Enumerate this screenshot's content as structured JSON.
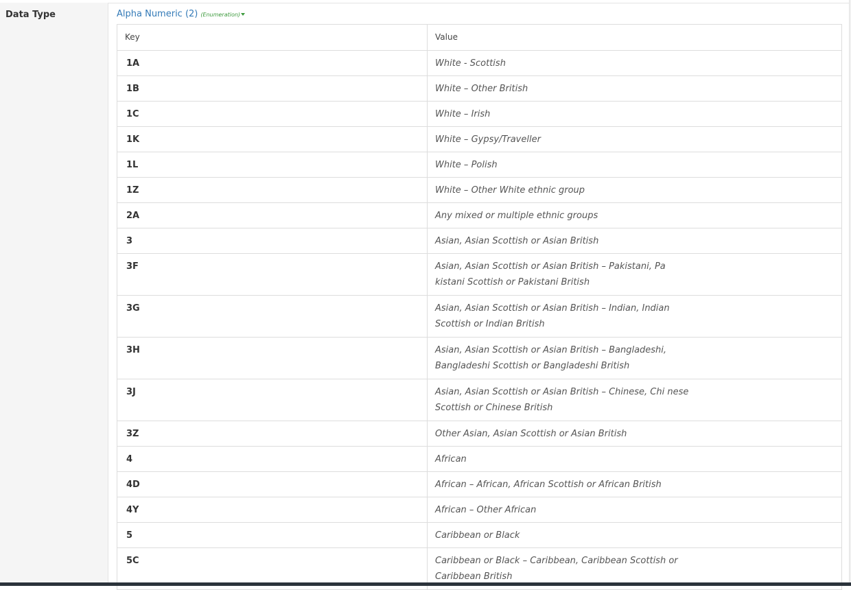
{
  "field_label": "Data Type",
  "data_type": {
    "name": "Alpha Numeric (2)",
    "kind": "(Enumeration)"
  },
  "table": {
    "headers": [
      "Key",
      "Value"
    ],
    "rows": [
      {
        "key": "1A",
        "value": "White - Scottish"
      },
      {
        "key": "1B",
        "value": "White – Other British"
      },
      {
        "key": "1C",
        "value": "White – Irish"
      },
      {
        "key": "1K",
        "value": "White – Gypsy/Traveller"
      },
      {
        "key": "1L",
        "value": "White – Polish"
      },
      {
        "key": "1Z",
        "value": "White – Other White ethnic group"
      },
      {
        "key": "2A",
        "value": "Any mixed or multiple ethnic groups"
      },
      {
        "key": "3",
        "value": "Asian, Asian Scottish or Asian British"
      },
      {
        "key": "3F",
        "value": "Asian, Asian Scottish or Asian British – Pakistani, Pa kistani Scottish or Pakistani British"
      },
      {
        "key": "3G",
        "value": "Asian, Asian Scottish or Asian British – Indian, Indian Scottish or Indian British"
      },
      {
        "key": "3H",
        "value": "Asian, Asian Scottish or Asian British – Bangladeshi, Bangladeshi Scottish or Bangladeshi British"
      },
      {
        "key": "3J",
        "value": "Asian, Asian Scottish or Asian British – Chinese, Chi nese Scottish or Chinese British"
      },
      {
        "key": "3Z",
        "value": "Other Asian, Asian Scottish or Asian British"
      },
      {
        "key": "4",
        "value": "African"
      },
      {
        "key": "4D",
        "value": "African – African, African Scottish or African British"
      },
      {
        "key": "4Y",
        "value": "African – Other African"
      },
      {
        "key": "5",
        "value": "Caribbean or Black"
      },
      {
        "key": "5C",
        "value": "Caribbean or Black – Caribbean, Caribbean Scottish or Caribbean British"
      }
    ]
  }
}
